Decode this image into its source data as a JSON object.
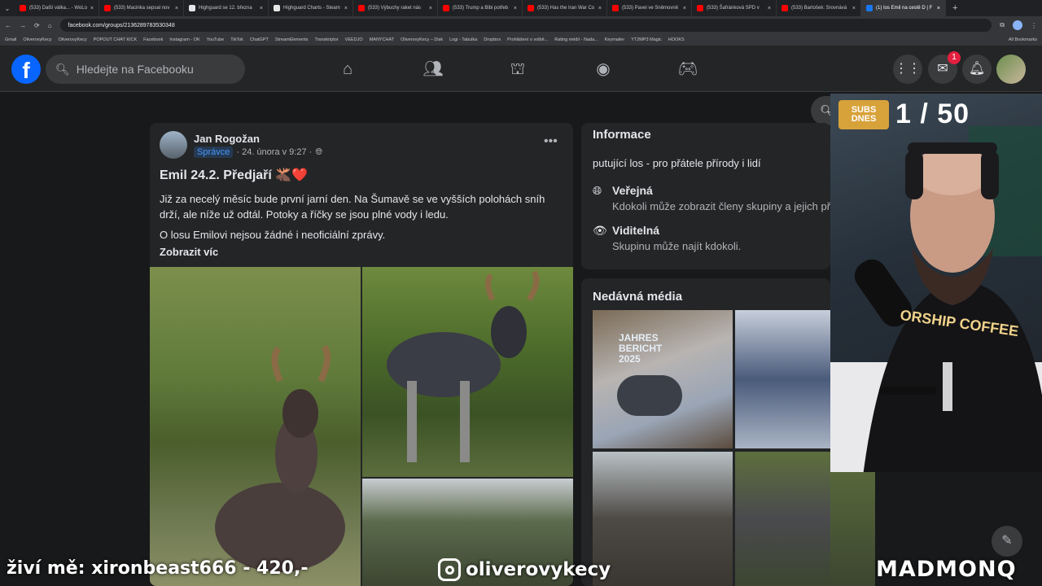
{
  "browser": {
    "tabs": [
      "(533) Další válka... - WoLo",
      "(533) Macinka sepsal nov",
      "Highguard se 12. března",
      "Highguard Charts - Steam",
      "(533) Výbuchy raket nás",
      "(533) Trump a Bibi potřeb",
      "(533) Has the Iran War Co",
      "(533) Pavel ve Sněmovně",
      "(533) Šafránková SPD v",
      "(533) Bartošek: Srovnává",
      "(1) Ios Emil na cestě D | F"
    ],
    "active_tab_index": 10,
    "url": "facebook.com/groups/2136289783530348",
    "bookmarks": [
      "Gmail",
      "OliverovyKecy",
      "OliverovyKecy",
      "POPOUT CHAT KICK",
      "Facebook",
      "Instagram - OK",
      "YouTube",
      "TikTok",
      "ChatGPT",
      "StreamElements",
      "Transkriptor",
      "VEEDJO",
      "MANYCHAT",
      "OliverovyKecy – Disk",
      "Logi - Tabulka",
      "Dropbox",
      "Prohlášení o volbě...",
      "Rating médií - Nada...",
      "Keymailer",
      "YT2MP3 Magic",
      "HOOKS"
    ],
    "all_bookmarks": "All Bookmarks"
  },
  "facebook": {
    "logo": "f",
    "search_placeholder": "Hledejte na Facebooku",
    "messenger_badge": "1",
    "post": {
      "author": "Jan Rogožan",
      "role": "Správce",
      "date": "· 24. února v 9:27 ·",
      "title": "Emil 24.2. Předjaří 🫎❤️",
      "paragraph1": "Již za necelý měsíc bude první jarní den. Na Šumavě se ve vyšších polohách sníh drží, ale níže už odtál. Potoky a říčky se jsou plné vody i ledu.",
      "paragraph2": "O losu Emilovi nejsou žádné i neoficiální zprávy.",
      "see_more": "Zobrazit víc"
    },
    "info": {
      "heading": "Informace",
      "description": "putující los - pro přátele přírody i lidí",
      "public_title": "Veřejná",
      "public_desc": "Kdokoli může zobrazit členy skupiny a jejich pří",
      "visible_title": "Viditelná",
      "visible_desc": "Skupinu může najít kdokoli."
    },
    "media": {
      "heading": "Nedávná média",
      "calendar_text": "JAHRES BERICHT 2025"
    }
  },
  "stream": {
    "subs_label": "SUBS DNES",
    "subs_count": "1 / 50",
    "donation": "živí mě: xironbeast666 - 420,-",
    "instagram": "oliverovykecy",
    "brand": "MADMONQ",
    "shirt_text": "ORSHIP COFFEE"
  }
}
